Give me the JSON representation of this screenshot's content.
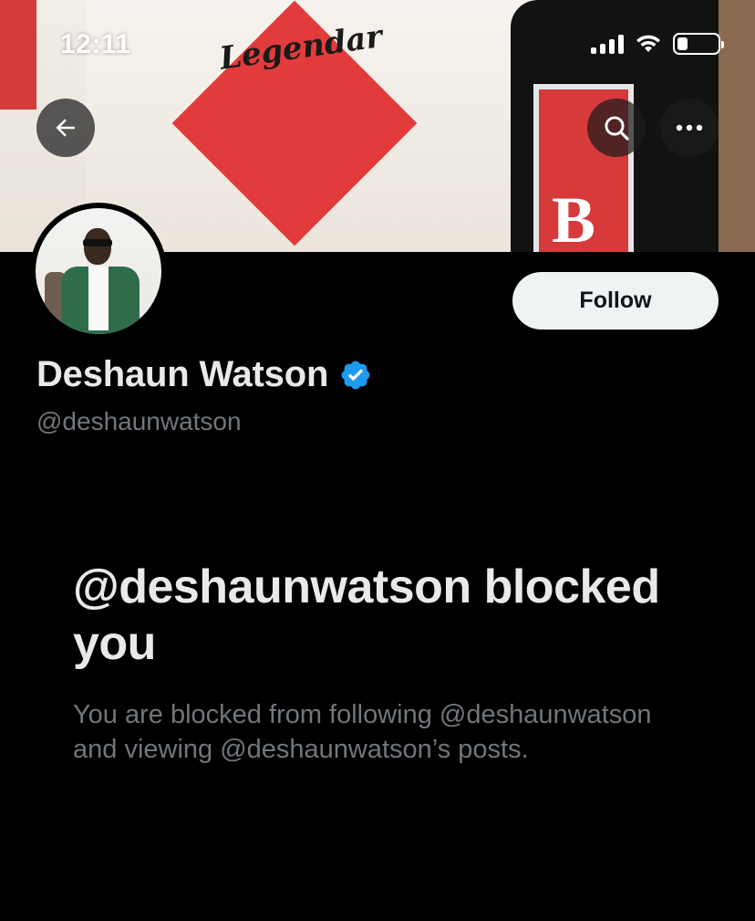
{
  "status_bar": {
    "time": "12:11",
    "signal_icon": "cellular-signal-icon",
    "wifi_icon": "wifi-icon",
    "battery_icon": "battery-low-icon",
    "battery_level": 0.2
  },
  "header": {
    "back_icon": "arrow-left-icon",
    "search_icon": "search-icon",
    "more_icon": "more-horizontal-icon",
    "banner_text": "Be Legendary"
  },
  "profile": {
    "display_name": "Deshaun Watson",
    "handle": "@deshaunwatson",
    "verified_icon": "verified-badge-icon",
    "follow_label": "Follow"
  },
  "blocked": {
    "title": "@deshaunwatson blocked you",
    "description": "You are blocked from following @deshaunwatson and viewing @deshaunwatson’s posts."
  },
  "colors": {
    "background": "#000000",
    "primary_text": "#e7e9ea",
    "secondary_text": "#71767b",
    "verified_blue": "#1d9bf0",
    "follow_bg": "#eff3f4",
    "follow_text": "#0f1419"
  }
}
